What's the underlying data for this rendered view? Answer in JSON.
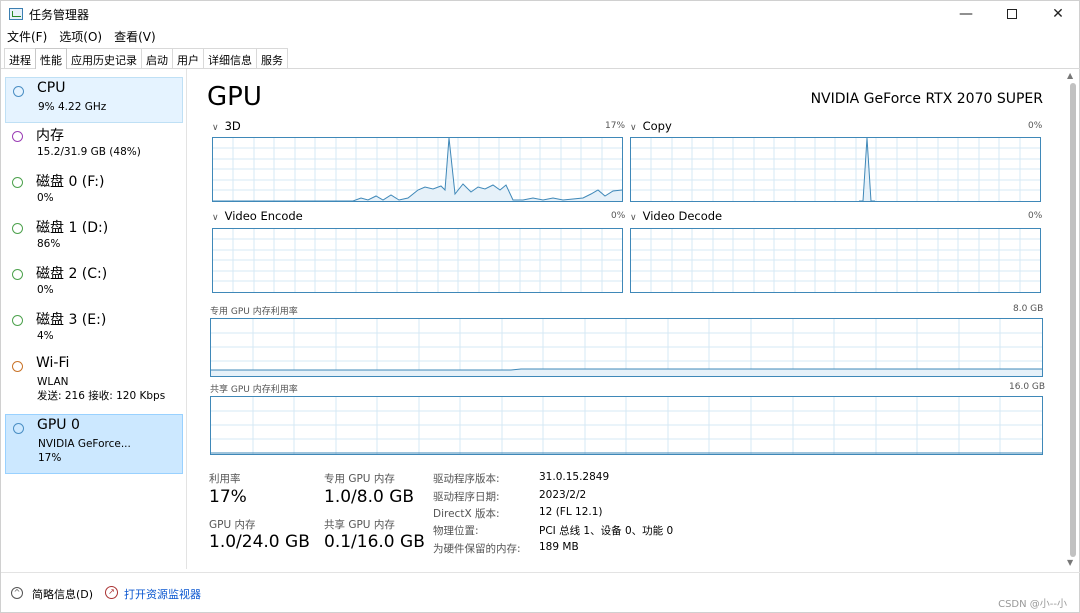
{
  "window": {
    "title": "任务管理器",
    "controls": {
      "minimize": "—",
      "close": "✕"
    }
  },
  "menu": [
    "文件(F)",
    "选项(O)",
    "查看(V)"
  ],
  "tabs": [
    "进程",
    "性能",
    "应用历史记录",
    "启动",
    "用户",
    "详细信息",
    "服务"
  ],
  "sidebar": {
    "items": [
      {
        "name": "CPU",
        "lines": [
          "9% 4.22 GHz"
        ],
        "color": "#4b8fc4"
      },
      {
        "name": "内存",
        "lines": [
          "15.2/31.9 GB (48%)"
        ],
        "color": "#9b3fb5"
      },
      {
        "name": "磁盘 0 (F:)",
        "lines": [
          "0%"
        ],
        "color": "#4ea24e"
      },
      {
        "name": "磁盘 1 (D:)",
        "lines": [
          "86%"
        ],
        "color": "#4ea24e"
      },
      {
        "name": "磁盘 2 (C:)",
        "lines": [
          "0%"
        ],
        "color": "#4ea24e"
      },
      {
        "name": "磁盘 3 (E:)",
        "lines": [
          "4%"
        ],
        "color": "#4ea24e"
      },
      {
        "name": "Wi-Fi",
        "lines": [
          "WLAN",
          "发送: 216  接收: 120 Kbps"
        ],
        "color": "#c9742a"
      },
      {
        "name": "GPU 0",
        "lines": [
          "NVIDIA GeForce...",
          "17%"
        ],
        "color": "#4b8fc4"
      }
    ]
  },
  "main": {
    "title": "GPU",
    "model": "NVIDIA GeForce RTX 2070 SUPER",
    "graphs": {
      "g3d": {
        "label": "3D",
        "value": "17%"
      },
      "copy": {
        "label": "Copy",
        "value": "0%"
      },
      "encode": {
        "label": "Video Encode",
        "value": "0%"
      },
      "decode": {
        "label": "Video Decode",
        "value": "0%"
      }
    },
    "dedicated_mem": {
      "label": "专用 GPU 内存利用率",
      "max": "8.0 GB"
    },
    "shared_mem": {
      "label": "共享 GPU 内存利用率",
      "max": "16.0 GB"
    },
    "stats": {
      "utilization": {
        "label": "利用率",
        "value": "17%"
      },
      "dedicated": {
        "label": "专用 GPU 内存",
        "value": "1.0/8.0 GB"
      },
      "gpu_memory": {
        "label": "GPU 内存",
        "value": "1.0/24.0 GB"
      },
      "shared": {
        "label": "共享 GPU 内存",
        "value": "0.1/16.0 GB"
      }
    },
    "info": [
      {
        "key": "驱动程序版本:",
        "value": "31.0.15.2849"
      },
      {
        "key": "驱动程序日期:",
        "value": "2023/2/2"
      },
      {
        "key": "DirectX 版本:",
        "value": "12 (FL 12.1)"
      },
      {
        "key": "物理位置:",
        "value": "PCI 总线 1、设备 0、功能 0"
      },
      {
        "key": "为硬件保留的内存:",
        "value": "189 MB"
      }
    ]
  },
  "bottom": {
    "summary": "简略信息(D)",
    "monitor": "打开资源监视器",
    "watermark": "CSDN @小--小"
  },
  "colors": {
    "graph_border": "#3f88b8",
    "graph_fill": "#e6f1f9",
    "selected": "#cce8ff",
    "link": "#0b57d0"
  }
}
